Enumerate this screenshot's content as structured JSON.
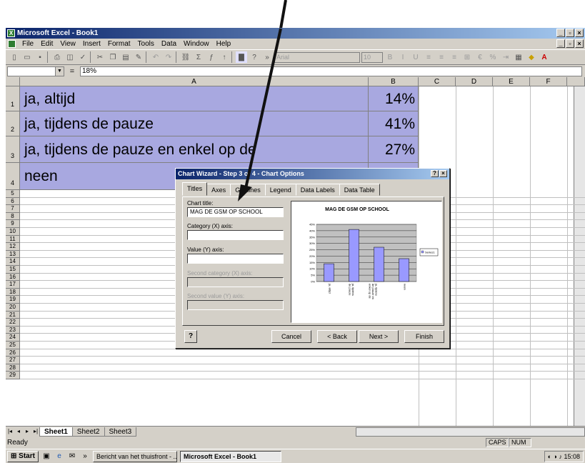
{
  "window": {
    "title": "Microsoft Excel - Book1",
    "app_icon": "excel-icon"
  },
  "menu": [
    "File",
    "Edit",
    "View",
    "Insert",
    "Format",
    "Tools",
    "Data",
    "Window",
    "Help"
  ],
  "toolbar": {
    "font_combo": "Arial",
    "size_combo": "10"
  },
  "formula_bar": {
    "name_box": "",
    "equals": "=",
    "value": "18%"
  },
  "columns": [
    "A",
    "B",
    "C",
    "D",
    "E",
    "F"
  ],
  "rows": [
    {
      "num": "1",
      "a": "ja, altijd",
      "b": "14%"
    },
    {
      "num": "2",
      "a": "ja, tijdens de pauze",
      "b": "41%"
    },
    {
      "num": "3",
      "a": "ja, tijdens de pauze en enkel op de",
      "b": "27%"
    },
    {
      "num": "4",
      "a": "neen",
      "b": ""
    }
  ],
  "row_numbers": [
    "5",
    "6",
    "7",
    "8",
    "9",
    "10",
    "11",
    "12",
    "13",
    "14",
    "15",
    "16",
    "17",
    "18",
    "19",
    "20",
    "21",
    "22",
    "23",
    "24",
    "25",
    "26",
    "27",
    "28",
    "29"
  ],
  "sheets": [
    "Sheet1",
    "Sheet2",
    "Sheet3"
  ],
  "status": {
    "text": "Ready",
    "caps": "CAPS",
    "num": "NUM"
  },
  "taskbar": {
    "start": "Start",
    "task1": "Bericht van het thuisfront - ...",
    "task2": "Microsoft Excel - Book1",
    "clock": "15:08"
  },
  "dialog": {
    "title": "Chart Wizard - Step 3 of 4 - Chart Options",
    "tabs": [
      "Titles",
      "Axes",
      "Gridlines",
      "Legend",
      "Data Labels",
      "Data Table"
    ],
    "chart_title_label": "Chart title:",
    "chart_title_value": "MAG DE GSM OP SCHOOL",
    "category_label": "Category (X) axis:",
    "value_label": "Value (Y) axis:",
    "second_category_label": "Second category (X) axis:",
    "second_value_label": "Second value (Y) axis:",
    "buttons": {
      "help": "?",
      "cancel": "Cancel",
      "back": "< Back",
      "next": "Next >",
      "finish": "Finish"
    }
  },
  "chart_data": {
    "type": "bar",
    "title": "MAG DE GSM OP SCHOOL",
    "categories": [
      "ja, altijd",
      "ja, tijdens de pauze",
      "ja, tijdens de pauze en enkel op de",
      "neen"
    ],
    "series": [
      {
        "name": "Series1",
        "values": [
          14,
          41,
          27,
          18
        ]
      }
    ],
    "ylim": [
      0,
      45
    ],
    "yticks": [
      "0%",
      "5%",
      "10%",
      "15%",
      "20%",
      "25%",
      "30%",
      "35%",
      "40%",
      "45%"
    ],
    "grid": true,
    "legend": "right"
  }
}
